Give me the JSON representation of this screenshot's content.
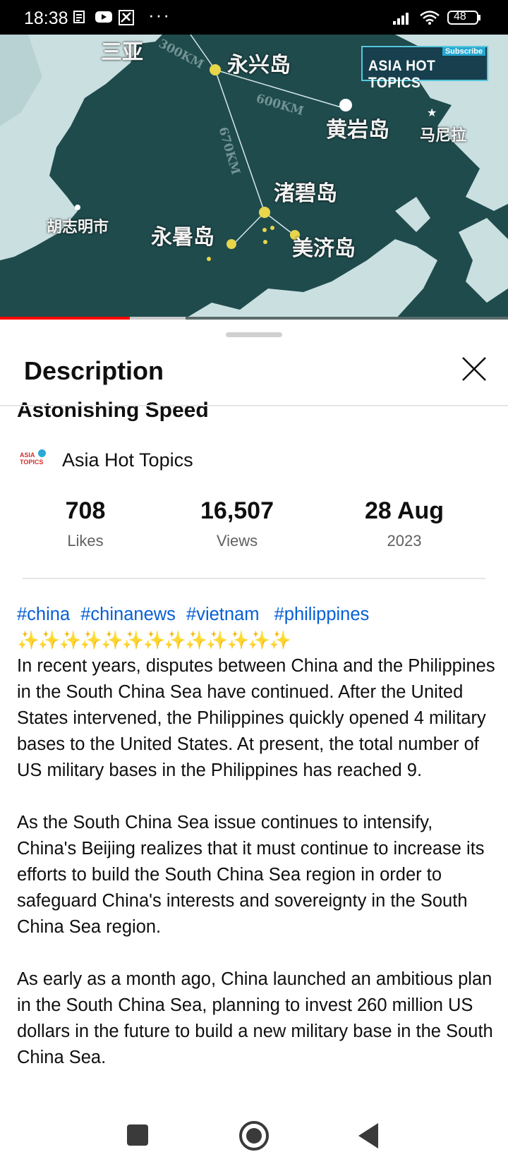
{
  "status_bar": {
    "time": "18:38",
    "battery": "48"
  },
  "video": {
    "overlay_logo": "ASIA HOT TOPICS",
    "overlay_subscribe": "Subscribe",
    "map_labels": {
      "sanya": "三亚",
      "yongxing": "永兴岛",
      "huangyan": "黄岩岛",
      "zhubi": "渚碧岛",
      "yongshu": "永暑岛",
      "meiji": "美济岛",
      "hcm": "胡志明市",
      "manila": "马尼拉"
    },
    "distances": {
      "d300": "300KM",
      "d600": "600KM",
      "d670": "670KM"
    },
    "progress_played": 0.255,
    "progress_buffered": 0.365
  },
  "sheet": {
    "title": "Description",
    "video_title_partial": "Astonishing Speed",
    "channel": {
      "name": "Asia Hot Topics",
      "logo_text_top": "ASIA",
      "logo_text_bottom": "TOPICS"
    },
    "stats": [
      {
        "value": "708",
        "label": "Likes"
      },
      {
        "value": "16,507",
        "label": "Views"
      },
      {
        "value": "28 Aug",
        "label": "2023"
      }
    ],
    "hashtags": [
      "#china",
      "#chinanews",
      "#vietnam",
      "#philippines"
    ],
    "sparkles": "✨✨✨✨✨✨✨✨✨✨✨✨✨",
    "paragraphs": [
      "In recent years, disputes between China and the Philippines in the South China Sea have continued. After the United States intervened, the Philippines quickly opened 4 military bases to the United States. At present, the total number of US military bases in the Philippines has reached 9.",
      "As the South China Sea issue continues to intensify, China's Beijing realizes that it must continue to increase its efforts to build the South China Sea region in order to safeguard China's interests and sovereignty in the South China Sea region.",
      "As early as a month ago, China launched an ambitious plan in the South China Sea, planning to invest 260 million US dollars in the future to build a new military base in the South China Sea."
    ]
  },
  "colors": {
    "hashtag": "#065fd4",
    "progress_played": "#ff0000",
    "sea": "#1e4a4c",
    "land": "#c9dede"
  }
}
